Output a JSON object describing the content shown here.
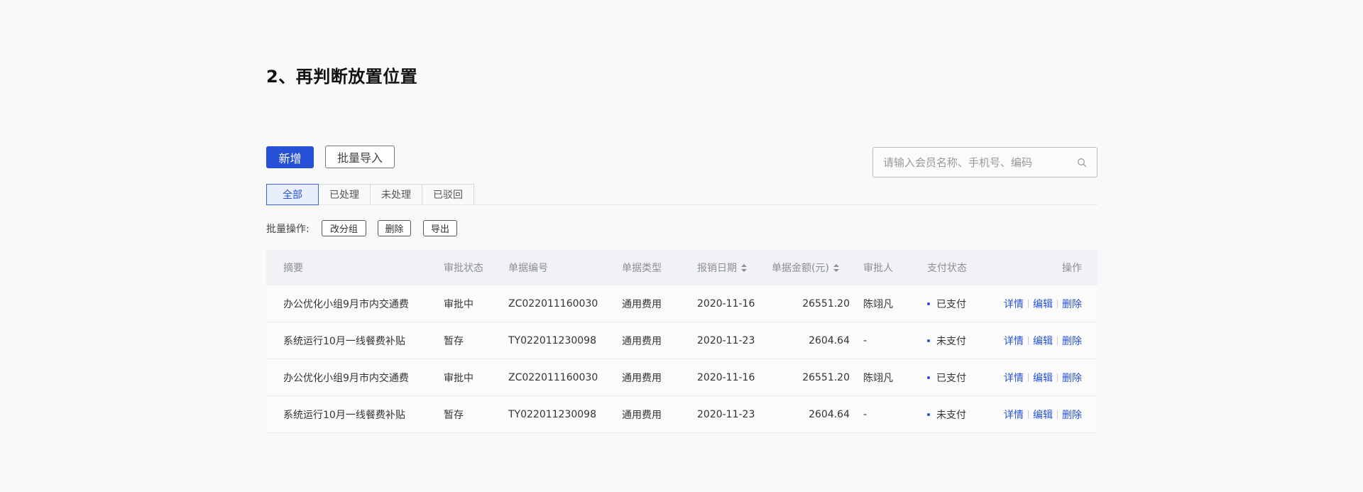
{
  "heading": "2、再判断放置位置",
  "toolbar": {
    "add_label": "新增",
    "import_label": "批量导入",
    "search_placeholder": "请输入会员名称、手机号、编码",
    "search_icon": "search-icon"
  },
  "tabs": [
    "全部",
    "已处理",
    "未处理",
    "已驳回"
  ],
  "active_tab": "全部",
  "batch": {
    "label": "批量操作:",
    "regroup": "改分组",
    "delete": "删除",
    "export": "导出"
  },
  "table": {
    "columns": {
      "summary": "摘要",
      "approval_status": "审批状态",
      "doc_no": "单据编号",
      "doc_type": "单据类型",
      "date": "报销日期",
      "amount": "单据金额(元)",
      "approver": "审批人",
      "pay_status": "支付状态",
      "actions": "操作"
    },
    "rows": [
      {
        "summary": "办公优化小组9月市内交通费",
        "approval_status": "审批中",
        "doc_no": "ZC022011160030",
        "doc_type": "通用费用",
        "date": "2020-11-16",
        "amount": "26551.20",
        "approver": "陈翊凡",
        "pay_status": "已支付"
      },
      {
        "summary": "系统运行10月一线餐费补贴",
        "approval_status": "暂存",
        "doc_no": "TY022011230098",
        "doc_type": "通用费用",
        "date": "2020-11-23",
        "amount": "2604.64",
        "approver": "-",
        "pay_status": "未支付"
      },
      {
        "summary": "办公优化小组9月市内交通费",
        "approval_status": "审批中",
        "doc_no": "ZC022011160030",
        "doc_type": "通用费用",
        "date": "2020-11-16",
        "amount": "26551.20",
        "approver": "陈翊凡",
        "pay_status": "已支付"
      },
      {
        "summary": "系统运行10月一线餐费补贴",
        "approval_status": "暂存",
        "doc_no": "TY022011230098",
        "doc_type": "通用费用",
        "date": "2020-11-23",
        "amount": "2604.64",
        "approver": "-",
        "pay_status": "未支付"
      }
    ],
    "row_actions": {
      "detail": "详情",
      "edit": "编辑",
      "delete": "删除"
    }
  },
  "colors": {
    "accent": "#2551d6",
    "header_bg": "#f1f2f5",
    "page_bg": "#f9f9fa"
  }
}
